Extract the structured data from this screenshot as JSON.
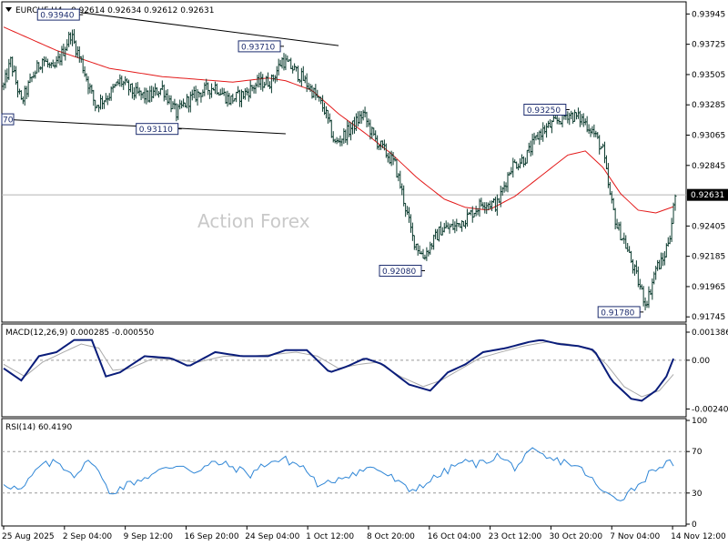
{
  "header": {
    "symbol_label": "EURCHF,H4",
    "ohlc": "0.92614 0.92634 0.92612 0.92631"
  },
  "watermark": "Action Forex",
  "colors": {
    "price_bar": "#0b3b2e",
    "ema_line": "#e31a1a",
    "macd_line": "#0a1d7a",
    "signal_line": "#a9a9a9",
    "rsi_line": "#2f86d6",
    "current_price_tag_bg": "#000000",
    "current_price_tag_text": "#ffffff"
  },
  "annotations": [
    {
      "label": "0.93940"
    },
    {
      "label": "0.93710"
    },
    {
      "label": "0.93110"
    },
    {
      "label": "0.92080"
    },
    {
      "label": "0.93250"
    },
    {
      "label": "0.91780"
    },
    {
      "label": "70"
    }
  ],
  "chart_data": [
    {
      "type": "candlestick",
      "title": "EURCHF,H4",
      "current_price_label": "0.92631",
      "y_ticks": [
        "0.93945",
        "0.93725",
        "0.93505",
        "0.93285",
        "0.93065",
        "0.92845",
        "0.92631",
        "0.92405",
        "0.92185",
        "0.91965",
        "0.91745"
      ],
      "ylim": [
        0.9172,
        0.9402
      ],
      "x_ticks": [
        "25 Aug 2025",
        "2 Sep 04:00",
        "9 Sep 12:00",
        "16 Sep 20:00",
        "24 Sep 04:00",
        "1 Oct 12:00",
        "8 Oct 20:00",
        "16 Oct 04:00",
        "23 Oct 12:00",
        "30 Oct 20:00",
        "7 Nov 04:00",
        "14 Nov 12:00"
      ],
      "price_path": [
        [
          0,
          0.9342
        ],
        [
          4,
          0.936
        ],
        [
          10,
          0.933
        ],
        [
          16,
          0.9348
        ],
        [
          22,
          0.9362
        ],
        [
          28,
          0.9353
        ],
        [
          34,
          0.9368
        ],
        [
          38,
          0.938
        ],
        [
          44,
          0.936
        ],
        [
          52,
          0.9328
        ],
        [
          60,
          0.9336
        ],
        [
          66,
          0.9346
        ],
        [
          74,
          0.9337
        ],
        [
          82,
          0.9334
        ],
        [
          90,
          0.9341
        ],
        [
          98,
          0.9322
        ],
        [
          104,
          0.9331
        ],
        [
          112,
          0.9338
        ],
        [
          120,
          0.9342
        ],
        [
          128,
          0.9332
        ],
        [
          136,
          0.9336
        ],
        [
          144,
          0.9344
        ],
        [
          152,
          0.9346
        ],
        [
          158,
          0.9361
        ],
        [
          164,
          0.9355
        ],
        [
          170,
          0.9347
        ],
        [
          176,
          0.9337
        ],
        [
          182,
          0.9325
        ],
        [
          188,
          0.93
        ],
        [
          196,
          0.931
        ],
        [
          204,
          0.9322
        ],
        [
          210,
          0.9305
        ],
        [
          216,
          0.9295
        ],
        [
          222,
          0.9285
        ],
        [
          226,
          0.9265
        ],
        [
          232,
          0.9232
        ],
        [
          238,
          0.9218
        ],
        [
          242,
          0.9226
        ],
        [
          248,
          0.9238
        ],
        [
          256,
          0.924
        ],
        [
          264,
          0.9248
        ],
        [
          272,
          0.9258
        ],
        [
          280,
          0.9256
        ],
        [
          288,
          0.9284
        ],
        [
          296,
          0.929
        ],
        [
          304,
          0.9308
        ],
        [
          312,
          0.9315
        ],
        [
          320,
          0.9322
        ],
        [
          328,
          0.9318
        ],
        [
          334,
          0.931
        ],
        [
          340,
          0.9295
        ],
        [
          344,
          0.9262
        ],
        [
          348,
          0.924
        ],
        [
          352,
          0.923
        ],
        [
          356,
          0.9215
        ],
        [
          360,
          0.92
        ],
        [
          364,
          0.9185
        ],
        [
          366,
          0.919
        ],
        [
          370,
          0.921
        ],
        [
          374,
          0.9215
        ],
        [
          378,
          0.9235
        ],
        [
          381,
          0.9262
        ]
      ],
      "series": [
        {
          "name": "Price (H4 bars)"
        },
        {
          "name": "EMA"
        }
      ],
      "ema_path": [
        [
          0,
          0.9385
        ],
        [
          30,
          0.9368
        ],
        [
          60,
          0.9355
        ],
        [
          90,
          0.9349
        ],
        [
          110,
          0.9347
        ],
        [
          130,
          0.9345
        ],
        [
          150,
          0.9348
        ],
        [
          160,
          0.9346
        ],
        [
          175,
          0.9339
        ],
        [
          190,
          0.9322
        ],
        [
          205,
          0.9308
        ],
        [
          220,
          0.9293
        ],
        [
          235,
          0.9275
        ],
        [
          250,
          0.926
        ],
        [
          262,
          0.9254
        ],
        [
          275,
          0.9252
        ],
        [
          290,
          0.9262
        ],
        [
          305,
          0.9277
        ],
        [
          320,
          0.9292
        ],
        [
          330,
          0.9295
        ],
        [
          340,
          0.9283
        ],
        [
          350,
          0.9264
        ],
        [
          360,
          0.9252
        ],
        [
          370,
          0.925
        ],
        [
          381,
          0.9255
        ]
      ],
      "trendlines": [
        {
          "from": [
            44,
            0.93955
          ],
          "to": [
            190,
            0.93715
          ]
        },
        {
          "from": [
            0,
            0.9318
          ],
          "to": [
            160,
            0.93075
          ]
        }
      ],
      "grid": false
    },
    {
      "type": "line",
      "title": "MACD(12,26,9) 0.000285 -0.000550",
      "y_ticks": [
        "0.001386",
        "0.00",
        "-0.002405"
      ],
      "ylim": [
        -0.0027,
        0.0017
      ],
      "series": [
        {
          "name": "MACD",
          "values": [
            [
              0,
              -0.0004
            ],
            [
              10,
              -0.001
            ],
            [
              20,
              0.0002
            ],
            [
              30,
              0.0004
            ],
            [
              40,
              0.001
            ],
            [
              50,
              0.001
            ],
            [
              58,
              -0.0008
            ],
            [
              66,
              -0.0006
            ],
            [
              80,
              0.0002
            ],
            [
              95,
              0.0001
            ],
            [
              105,
              -0.0003
            ],
            [
              120,
              0.0004
            ],
            [
              135,
              0.0002
            ],
            [
              150,
              0.0002
            ],
            [
              160,
              0.0005
            ],
            [
              172,
              0.0005
            ],
            [
              185,
              -0.0006
            ],
            [
              195,
              -0.0003
            ],
            [
              205,
              0.0001
            ],
            [
              215,
              -0.0002
            ],
            [
              230,
              -0.0012
            ],
            [
              242,
              -0.0015
            ],
            [
              252,
              -0.0006
            ],
            [
              262,
              -0.0002
            ],
            [
              272,
              0.0004
            ],
            [
              285,
              0.0006
            ],
            [
              298,
              0.0009
            ],
            [
              305,
              0.001
            ],
            [
              315,
              0.0008
            ],
            [
              326,
              0.0007
            ],
            [
              335,
              0.0005
            ],
            [
              345,
              -0.001
            ],
            [
              356,
              -0.0019
            ],
            [
              362,
              -0.002
            ],
            [
              370,
              -0.0015
            ],
            [
              376,
              -0.0008
            ],
            [
              381,
              0.0003
            ]
          ]
        },
        {
          "name": "Signal",
          "values": [
            [
              0,
              -0.0002
            ],
            [
              12,
              -0.0008
            ],
            [
              22,
              -0.0001
            ],
            [
              34,
              0.0004
            ],
            [
              44,
              0.0008
            ],
            [
              54,
              0.0006
            ],
            [
              62,
              -0.0005
            ],
            [
              72,
              -0.0004
            ],
            [
              85,
              0.0001
            ],
            [
              100,
              0.0
            ],
            [
              110,
              -0.0001
            ],
            [
              125,
              0.0002
            ],
            [
              140,
              0.0002
            ],
            [
              155,
              0.0003
            ],
            [
              166,
              0.0004
            ],
            [
              178,
              0.0002
            ],
            [
              190,
              -0.0004
            ],
            [
              202,
              -0.0002
            ],
            [
              212,
              -0.0001
            ],
            [
              225,
              -0.0008
            ],
            [
              238,
              -0.0013
            ],
            [
              248,
              -0.001
            ],
            [
              258,
              -0.0005
            ],
            [
              270,
              0.0001
            ],
            [
              282,
              0.0004
            ],
            [
              295,
              0.0007
            ],
            [
              308,
              0.0009
            ],
            [
              320,
              0.0008
            ],
            [
              332,
              0.0006
            ],
            [
              342,
              -0.0002
            ],
            [
              352,
              -0.0013
            ],
            [
              362,
              -0.0018
            ],
            [
              372,
              -0.0015
            ],
            [
              381,
              -0.0006
            ]
          ]
        }
      ],
      "zero_line": true
    },
    {
      "type": "line",
      "title": "RSI(14) 60.4190",
      "y_ticks": [
        "100",
        "70",
        "30",
        "0"
      ],
      "ylim": [
        0,
        100
      ],
      "levels": [
        70,
        30
      ],
      "series": [
        {
          "name": "RSI",
          "values": [
            [
              0,
              40
            ],
            [
              10,
              32
            ],
            [
              20,
              55
            ],
            [
              30,
              60
            ],
            [
              40,
              48
            ],
            [
              50,
              62
            ],
            [
              60,
              30
            ],
            [
              70,
              38
            ],
            [
              80,
              45
            ],
            [
              90,
              52
            ],
            [
              100,
              58
            ],
            [
              110,
              50
            ],
            [
              120,
              60
            ],
            [
              130,
              55
            ],
            [
              140,
              48
            ],
            [
              150,
              60
            ],
            [
              160,
              62
            ],
            [
              170,
              55
            ],
            [
              180,
              35
            ],
            [
              190,
              45
            ],
            [
              200,
              50
            ],
            [
              210,
              55
            ],
            [
              220,
              45
            ],
            [
              230,
              32
            ],
            [
              240,
              40
            ],
            [
              250,
              50
            ],
            [
              260,
              60
            ],
            [
              270,
              58
            ],
            [
              280,
              66
            ],
            [
              290,
              55
            ],
            [
              300,
              70
            ],
            [
              310,
              62
            ],
            [
              320,
              60
            ],
            [
              330,
              50
            ],
            [
              340,
              30
            ],
            [
              350,
              25
            ],
            [
              360,
              38
            ],
            [
              370,
              55
            ],
            [
              381,
              60
            ]
          ]
        }
      ]
    }
  ]
}
